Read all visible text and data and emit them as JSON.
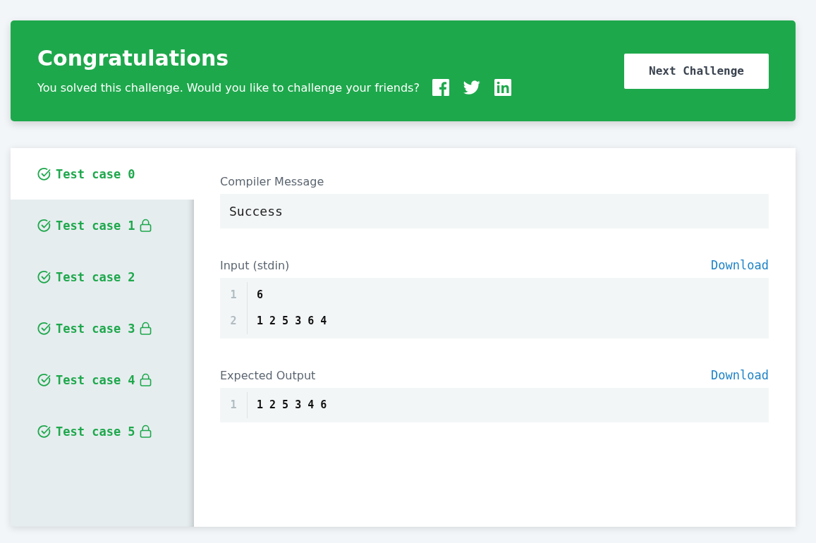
{
  "banner": {
    "title": "Congratulations",
    "message": "You solved this challenge. Would you like to challenge your friends?",
    "button": "Next Challenge"
  },
  "test_cases": [
    {
      "label": "Test case 0",
      "passed": true,
      "locked": false,
      "selected": true
    },
    {
      "label": "Test case 1",
      "passed": true,
      "locked": true,
      "selected": false
    },
    {
      "label": "Test case 2",
      "passed": true,
      "locked": false,
      "selected": false
    },
    {
      "label": "Test case 3",
      "passed": true,
      "locked": true,
      "selected": false
    },
    {
      "label": "Test case 4",
      "passed": true,
      "locked": true,
      "selected": false
    },
    {
      "label": "Test case 5",
      "passed": true,
      "locked": true,
      "selected": false
    }
  ],
  "sections": [
    {
      "kind": "message",
      "label": "Compiler Message",
      "text": "Success"
    },
    {
      "kind": "code",
      "label": "Input (stdin)",
      "download": "Download",
      "lines": [
        {
          "number": "1",
          "text": "6"
        },
        {
          "number": "2",
          "text": "1 2 5 3 6 4"
        }
      ]
    },
    {
      "kind": "code",
      "label": "Expected Output",
      "download": "Download",
      "lines": [
        {
          "number": "1",
          "text": "1 2 5 3 4 6"
        }
      ]
    }
  ]
}
